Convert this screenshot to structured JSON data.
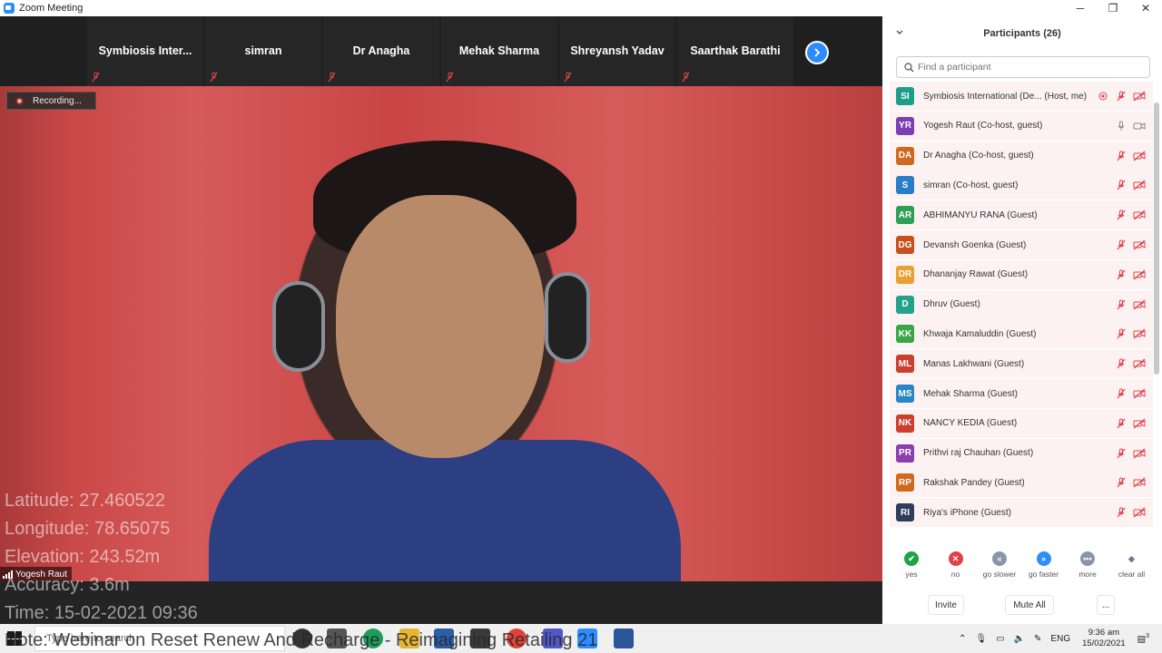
{
  "window": {
    "title": "Zoom Meeting",
    "minimize": "─",
    "maximize": "❐",
    "close": "✕"
  },
  "strip": {
    "tiles": [
      {
        "name": "Symbiosis  Inter..."
      },
      {
        "name": "simran"
      },
      {
        "name": "Dr Anagha"
      },
      {
        "name": "Mehak Sharma"
      },
      {
        "name": "Shreyansh Yadav"
      },
      {
        "name": "Saarthak Barathi"
      }
    ],
    "next_icon": "chevron-right-icon"
  },
  "recording_label": "Recording...",
  "speaker_name": "Yogesh Raut",
  "geo_overlay": {
    "latitude": "Latitude: 27.460522",
    "longitude": "Longitude: 78.65075",
    "elevation": "Elevation: 243.52m",
    "accuracy": "Accuracy: 3.6m",
    "time": "Time: 15-02-2021  09:36",
    "note": "Note: Webinar on Reset  Renew And Recharge - Reimagining Retailing  21"
  },
  "panel": {
    "title": "Participants (26)",
    "search_placeholder": "Find a participant",
    "participants": [
      {
        "initials": "SI",
        "color": "#1e9e8a",
        "name": "Symbiosis International (De...  (Host, me)",
        "mic": "muted",
        "video": "off",
        "extra": "record-icon"
      },
      {
        "initials": "YR",
        "color": "#7b3fb0",
        "name": "Yogesh Raut (Co-host, guest)",
        "mic": "on",
        "video": "on"
      },
      {
        "initials": "DA",
        "color": "#d0681d",
        "name": "Dr Anagha (Co-host, guest)",
        "mic": "muted",
        "video": "off"
      },
      {
        "initials": "S",
        "color": "#2a7dc8",
        "name": "simran (Co-host, guest)",
        "mic": "muted",
        "video": "off"
      },
      {
        "initials": "AR",
        "color": "#2f9e57",
        "name": "ABHIMANYU RANA (Guest)",
        "mic": "muted",
        "video": "off"
      },
      {
        "initials": "DG",
        "color": "#c8501d",
        "name": "Devansh Goenka (Guest)",
        "mic": "muted",
        "video": "off"
      },
      {
        "initials": "DR",
        "color": "#e8a030",
        "name": "Dhananjay Rawat (Guest)",
        "mic": "muted",
        "video": "off"
      },
      {
        "initials": "D",
        "color": "#25a08a",
        "name": "Dhruv (Guest)",
        "mic": "muted",
        "video": "off"
      },
      {
        "initials": "KK",
        "color": "#3aa64a",
        "name": "Khwaja Kamaluddin (Guest)",
        "mic": "muted",
        "video": "off"
      },
      {
        "initials": "ML",
        "color": "#c9402f",
        "name": "Manas Lakhwani (Guest)",
        "mic": "muted",
        "video": "off"
      },
      {
        "initials": "MS",
        "color": "#2a86c4",
        "name": "Mehak Sharma (Guest)",
        "mic": "muted",
        "video": "off"
      },
      {
        "initials": "NK",
        "color": "#c9402f",
        "name": "NANCY KEDIA (Guest)",
        "mic": "muted",
        "video": "off"
      },
      {
        "initials": "PR",
        "color": "#8a3fb0",
        "name": "Prithvi raj Chauhan (Guest)",
        "mic": "muted",
        "video": "off"
      },
      {
        "initials": "RP",
        "color": "#d0681d",
        "name": "Rakshak Pandey (Guest)",
        "mic": "muted",
        "video": "off"
      },
      {
        "initials": "RI",
        "color": "#2f3d5c",
        "name": "Riya's iPhone (Guest)",
        "mic": "muted",
        "video": "off"
      }
    ],
    "reactions": [
      {
        "label": "yes",
        "symbol": "✔",
        "color": "#1fa34a"
      },
      {
        "label": "no",
        "symbol": "✕",
        "color": "#e0414a"
      },
      {
        "label": "go slower",
        "symbol": "«",
        "color": "#8a96a8"
      },
      {
        "label": "go faster",
        "symbol": "»",
        "color": "#2d8cff"
      },
      {
        "label": "more",
        "symbol": "•••",
        "color": "#8a96a8"
      },
      {
        "label": "clear all",
        "symbol": "◆",
        "color": "#ffffff"
      }
    ],
    "footer": {
      "invite": "Invite",
      "mute_all": "Mute All",
      "more": "..."
    }
  },
  "taskbar": {
    "search_placeholder": "Type here to search",
    "tray": {
      "lang": "ENG",
      "time": "9:36 am",
      "date": "15/02/2021",
      "notifications": "3"
    }
  }
}
